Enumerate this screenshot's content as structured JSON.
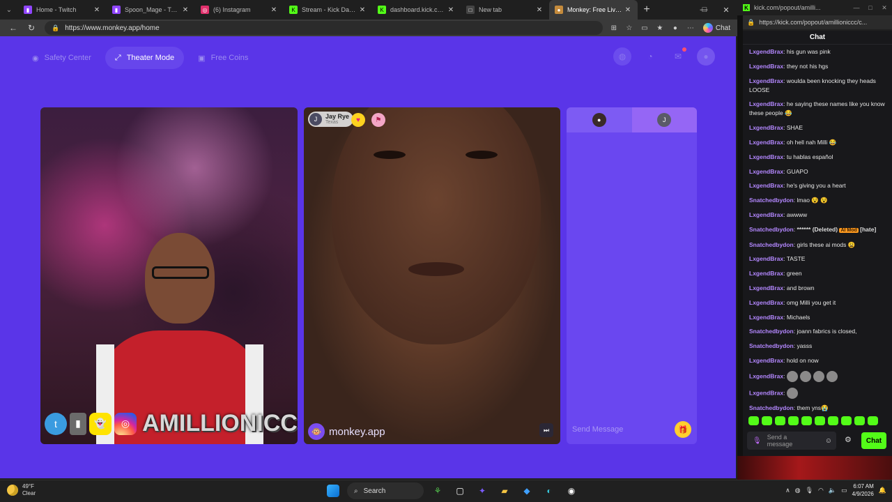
{
  "browser": {
    "tabs": [
      {
        "title": "Home - Twitch",
        "color": "#9146ff",
        "glyph": "▮"
      },
      {
        "title": "Spoon_Mage - Twitch",
        "color": "#9146ff",
        "glyph": "▮"
      },
      {
        "title": "(6) Instagram",
        "color": "#e1306c",
        "glyph": "◎"
      },
      {
        "title": "Stream - Kick Dashboard",
        "color": "#53fc18",
        "glyph": "K"
      },
      {
        "title": "dashboard.kick.com/lxge",
        "color": "#53fc18",
        "glyph": "K"
      },
      {
        "title": "New tab",
        "color": "#444444",
        "glyph": "□"
      },
      {
        "title": "Monkey: Free Live Vi",
        "color": "#c58b3c",
        "glyph": "🐵"
      }
    ],
    "url": "https://www.monkey.app/home",
    "copilot_label": "Chat"
  },
  "monkey": {
    "nav": {
      "safety": "Safety Center",
      "theater": "Theater Mode",
      "coins": "Free Coins"
    },
    "match_user": {
      "initial": "J",
      "name": "Jay Rye",
      "location": "Texas"
    },
    "brand": "monkey.app",
    "streamer_overlay": "AMILLIONICCC",
    "chat_tab_initial": "J",
    "send_placeholder": "Send Message"
  },
  "kick": {
    "url_short": "kick.com/popout/amilli...",
    "url_full": "https://kick.com/popout/amillioniccc/c...",
    "chat_title": "Chat",
    "messages": [
      {
        "user": "LxgendBrax",
        "text": "his gun was pink"
      },
      {
        "user": "LxgendBrax",
        "text": "they not his hgs"
      },
      {
        "user": "LxgendBrax",
        "text": "woulda been knocking they heads LOOSE"
      },
      {
        "user": "LxgendBrax",
        "text": "he saying these names like you know these people 😂"
      },
      {
        "user": "LxgendBrax",
        "text": "SHAE"
      },
      {
        "user": "LxgendBrax",
        "text": "oh hell nah Milli 😂"
      },
      {
        "user": "LxgendBrax",
        "text": "tu hablas español"
      },
      {
        "user": "LxgendBrax",
        "text": "GUAPO"
      },
      {
        "user": "LxgendBrax",
        "text": "he's giving you a heart"
      },
      {
        "user": "Snatchedbydon",
        "text": "lmao 😵 😵"
      },
      {
        "user": "LxgendBrax",
        "text": "awwww"
      },
      {
        "user": "Snatchedbydon",
        "text": "****** (Deleted)",
        "ai_mod": "AI Mod",
        "tail": "[hate]"
      },
      {
        "user": "Snatchedbydon",
        "text": "girls these ai mods 😩"
      },
      {
        "user": "LxgendBrax",
        "text": "TASTE"
      },
      {
        "user": "LxgendBrax",
        "text": "green"
      },
      {
        "user": "LxgendBrax",
        "text": "and brown"
      },
      {
        "user": "LxgendBrax",
        "text": "omg Milli you get it"
      },
      {
        "user": "LxgendBrax",
        "text": "Michaels"
      },
      {
        "user": "Snatchedbydon",
        "text": "joann fabrics is closed,"
      },
      {
        "user": "Snatchedbydon",
        "text": "yasss"
      },
      {
        "user": "LxgendBrax",
        "text": "hold on now"
      },
      {
        "user": "LxgendBrax",
        "text": "",
        "emotes": 4
      },
      {
        "user": "LxgendBrax",
        "text": "",
        "emotes": 1
      },
      {
        "user": "Snatchedbydon",
        "text": "them yns😭"
      }
    ],
    "input_placeholder": "Send a message",
    "send_label": "Chat"
  },
  "taskbar": {
    "temp": "49°F",
    "condition": "Clear",
    "search": "Search",
    "time": "6:07 AM",
    "date": "4/9/2026"
  }
}
